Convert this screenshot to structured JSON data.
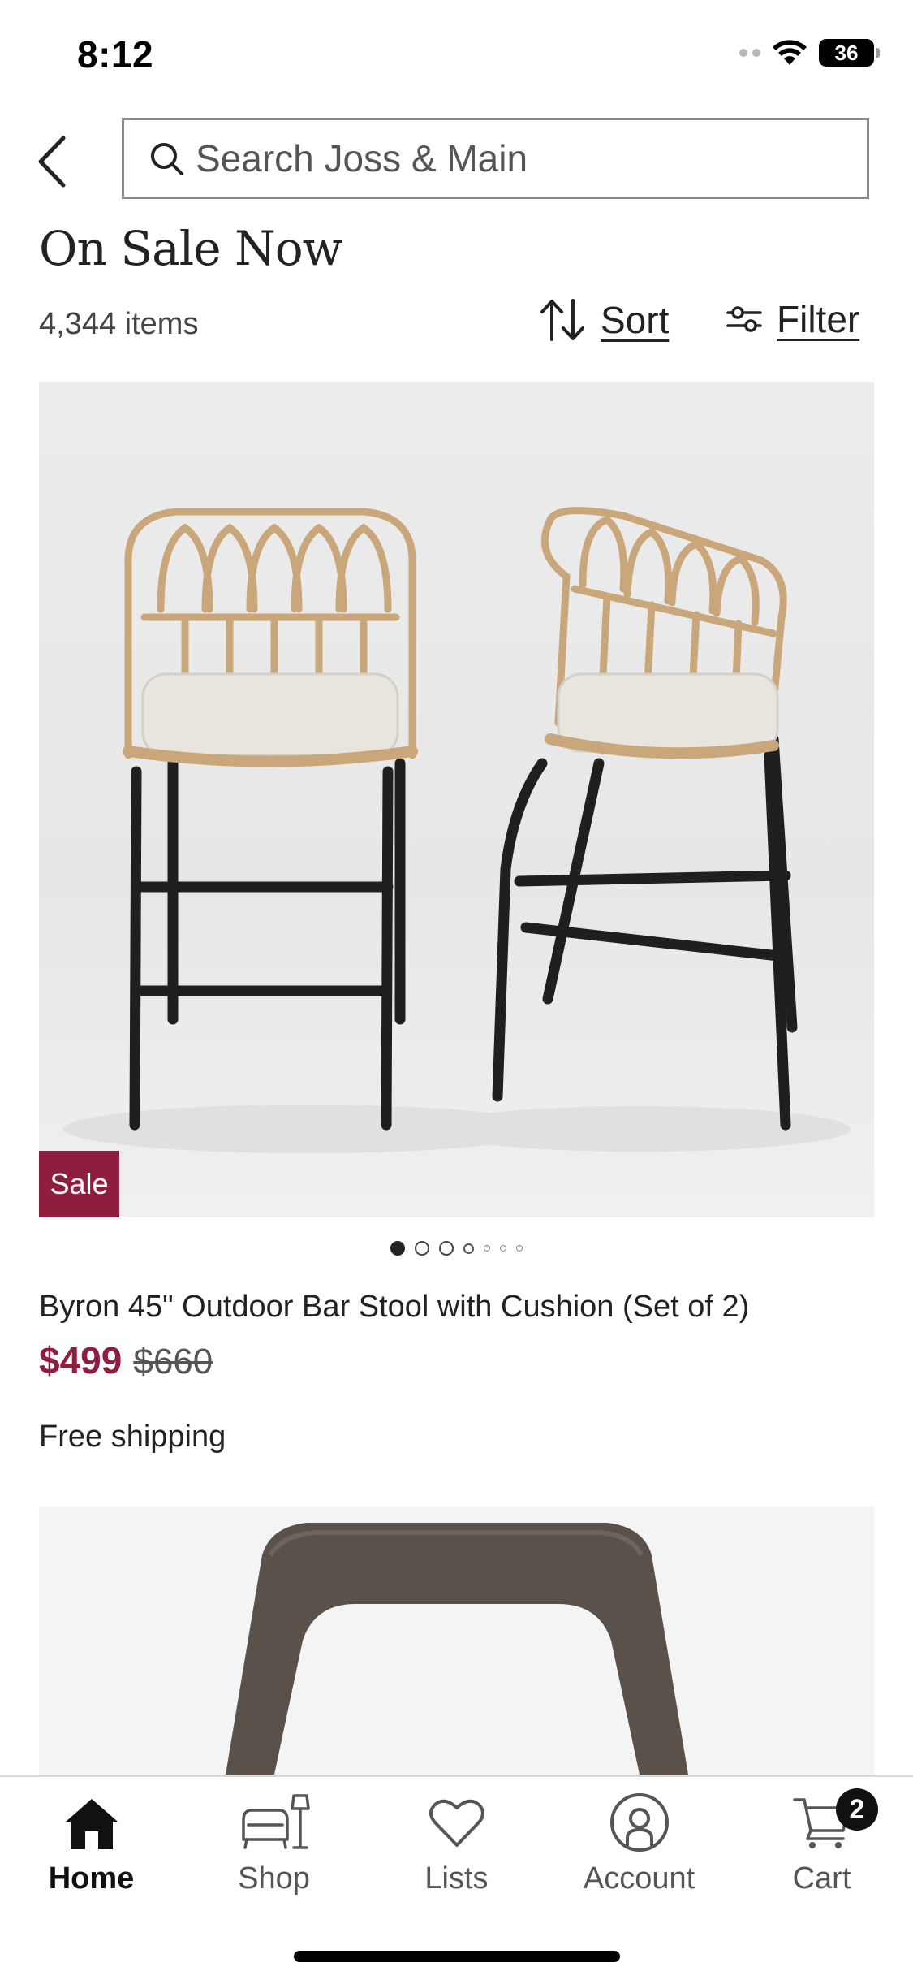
{
  "status_bar": {
    "time": "8:12",
    "battery": "36"
  },
  "search": {
    "placeholder": "Search Joss & Main"
  },
  "page": {
    "title": "On Sale Now",
    "item_count": "4,344 items"
  },
  "toolbar": {
    "sort_label": "Sort",
    "filter_label": "Filter"
  },
  "products": [
    {
      "badge": "Sale",
      "name": "Byron 45\" Outdoor Bar Stool with Cushion (Set of 2)",
      "price": "$499",
      "original_price": "$660",
      "shipping": "Free shipping",
      "image_count": 7,
      "active_image": 1
    }
  ],
  "tabs": [
    {
      "label": "Home",
      "icon": "home-icon",
      "active": true
    },
    {
      "label": "Shop",
      "icon": "shop-icon",
      "active": false
    },
    {
      "label": "Lists",
      "icon": "heart-icon",
      "active": false
    },
    {
      "label": "Account",
      "icon": "account-icon",
      "active": false
    },
    {
      "label": "Cart",
      "icon": "cart-icon",
      "active": false
    }
  ],
  "cart_count": "2",
  "colors": {
    "sale": "#8f1d3f",
    "text": "#222222",
    "border": "#8a8a8a"
  }
}
